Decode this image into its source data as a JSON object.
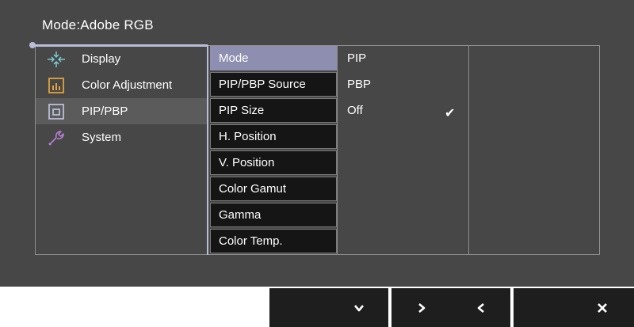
{
  "osd": {
    "title": "Mode:Adobe RGB"
  },
  "main_menu": {
    "items": [
      {
        "label": "Display",
        "icon": "display-icon",
        "color": "#7fd1d6"
      },
      {
        "label": "Color Adjustment",
        "icon": "color-adjustment-icon",
        "color": "#e2a23c"
      },
      {
        "label": "PIP/PBP",
        "icon": "pip-pbp-icon",
        "color": "#b9bdd8",
        "active": true
      },
      {
        "label": "System",
        "icon": "system-wrench-icon",
        "color": "#b57fd1"
      }
    ]
  },
  "sub_menu": {
    "items": [
      {
        "label": "Mode",
        "selected": true
      },
      {
        "label": "PIP/PBP Source"
      },
      {
        "label": "PIP Size"
      },
      {
        "label": "H. Position"
      },
      {
        "label": "V. Position"
      },
      {
        "label": "Color Gamut"
      },
      {
        "label": "Gamma"
      },
      {
        "label": "Color Temp."
      }
    ]
  },
  "options": {
    "items": [
      {
        "label": "PIP"
      },
      {
        "label": "PBP"
      },
      {
        "label": "Off",
        "checked": true
      }
    ],
    "check_glyph": "✔"
  },
  "hotkeys": {
    "items": [
      {
        "icon": "blank-key"
      },
      {
        "icon": "chevron-down-icon"
      },
      {
        "icon": "chevron-right-icon"
      },
      {
        "icon": "chevron-left-icon"
      },
      {
        "icon": "close-icon"
      }
    ]
  },
  "colors": {
    "osd_background": "#474747",
    "accent": "#b9bdd8",
    "selected_item": "#8e8fb0",
    "key_background": "#1e1e1e"
  }
}
